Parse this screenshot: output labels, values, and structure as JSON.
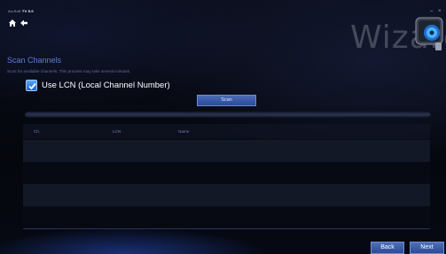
{
  "app": {
    "brand_prefix": "ArcSoft",
    "brand_name": "TV 5.0",
    "wizard_title": "Wizard"
  },
  "page": {
    "heading": "Scan Channels",
    "subtext": "Scan for available channels. This process may take several minutes."
  },
  "options": {
    "use_lcn_label": "Use LCN (Local Channel Number)",
    "use_lcn_checked": true
  },
  "buttons": {
    "scan": "Scan",
    "back": "Back",
    "next": "Next"
  },
  "scan_progress": 0,
  "table": {
    "columns": [
      "Ch.",
      "LCN",
      "Name"
    ],
    "rows": [
      {
        "ch": "",
        "lcn": "",
        "name": ""
      },
      {
        "ch": "",
        "lcn": "",
        "name": ""
      },
      {
        "ch": "",
        "lcn": "",
        "name": ""
      },
      {
        "ch": "",
        "lcn": "",
        "name": ""
      }
    ]
  },
  "icons": {
    "home": "home-icon",
    "back": "back-arrow-icon",
    "minimize": "minimize-icon",
    "close": "close-icon",
    "logo": "arcsoft-tv-logo-icon"
  },
  "colors": {
    "accent": "#5c7fd6",
    "button": "#3a5aa8",
    "checkbox": "#3a86f0"
  }
}
